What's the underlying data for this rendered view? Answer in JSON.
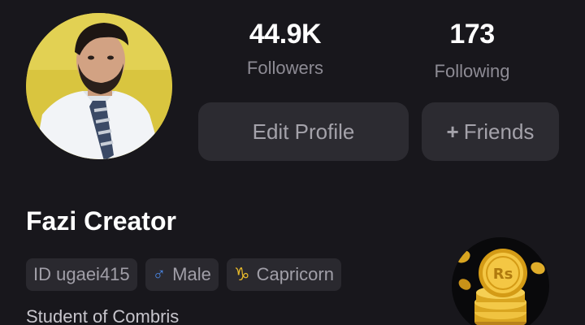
{
  "profile": {
    "name": "Fazi Creator",
    "bio": "Student of Combris"
  },
  "stats": {
    "followers": {
      "value": "44.9K",
      "label": "Followers"
    },
    "following": {
      "value": "173",
      "label": "Following"
    }
  },
  "actions": {
    "edit_profile": "Edit Profile",
    "friends_plus": "+",
    "friends": "Friends"
  },
  "tags": {
    "id": "ID ugaei415",
    "gender_icon": "♂",
    "gender": "Male",
    "zodiac_icon": "♑",
    "zodiac": "Capricorn"
  },
  "coin": {
    "symbol": "Rs"
  },
  "colors": {
    "background": "#18171c",
    "button": "#2c2b31",
    "tag": "#2a292f",
    "male": "#4a87e6",
    "zodiac": "#e7b92a"
  }
}
